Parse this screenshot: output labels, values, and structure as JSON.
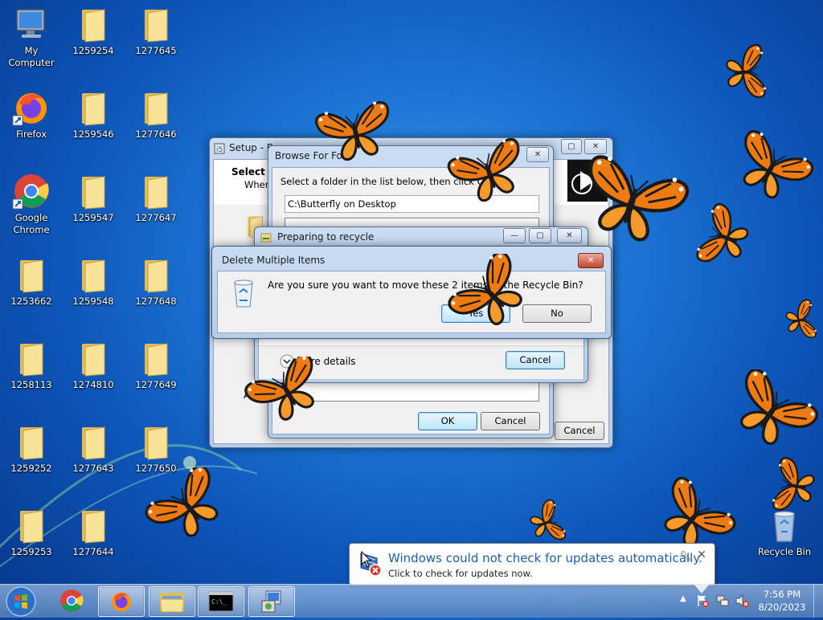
{
  "desktop": {
    "icons": [
      {
        "label": "My Computer",
        "icon": "computer-icon"
      },
      {
        "label": "1259254",
        "icon": "folder-icon"
      },
      {
        "label": "1277645",
        "icon": "folder-icon"
      },
      {
        "label": "Firefox",
        "icon": "firefox-icon"
      },
      {
        "label": "1259546",
        "icon": "folder-icon"
      },
      {
        "label": "1277646",
        "icon": "folder-icon"
      },
      {
        "label": "Google Chrome",
        "icon": "chrome-icon"
      },
      {
        "label": "1259547",
        "icon": "folder-icon"
      },
      {
        "label": "1277647",
        "icon": "folder-icon"
      },
      {
        "label": "1253662",
        "icon": "folder-icon"
      },
      {
        "label": "1259548",
        "icon": "folder-icon"
      },
      {
        "label": "1277648",
        "icon": "folder-icon"
      },
      {
        "label": "1258113",
        "icon": "folder-icon"
      },
      {
        "label": "1274810",
        "icon": "folder-icon"
      },
      {
        "label": "1277649",
        "icon": "folder-icon"
      },
      {
        "label": "1259252",
        "icon": "folder-icon"
      },
      {
        "label": "1277643",
        "icon": "folder-icon"
      },
      {
        "label": "1277650",
        "icon": "folder-icon"
      },
      {
        "label": "1259253",
        "icon": "folder-icon"
      },
      {
        "label": "1277644",
        "icon": "folder-icon"
      }
    ],
    "recycle_bin": {
      "label": "Recycle Bin"
    }
  },
  "setup_window": {
    "title": "Setup - Butterfly on Desktop",
    "title_visible": "Setup - B",
    "heading": "Select D",
    "subheading": "Where",
    "footer_text": "At l",
    "cancel_label": "Cancel"
  },
  "browse_dialog": {
    "title": "Browse For Fold",
    "instruction": "Select a folder in the list below, then click OK.",
    "path_value": "C:\\Butterfly on Desktop",
    "ok_label": "OK",
    "cancel_label": "Cancel"
  },
  "recycle_progress": {
    "title": "Preparing to recycle",
    "more_details_label": "More details",
    "cancel_label": "Cancel"
  },
  "delete_dialog": {
    "title": "Delete Multiple Items",
    "message": "Are you sure you want to move these 2 items to the Recycle Bin?",
    "yes_label": "Yes",
    "no_label": "No"
  },
  "notification": {
    "title": "Windows could not check for updates automatically.",
    "body": "Click to check for updates now."
  },
  "taskbar": {
    "items": [
      {
        "name": "chrome",
        "icon": "chrome-icon"
      },
      {
        "name": "firefox",
        "icon": "firefox-icon"
      },
      {
        "name": "explorer",
        "icon": "folder-icon"
      },
      {
        "name": "command-prompt",
        "icon": "cmd-icon"
      },
      {
        "name": "setup",
        "icon": "installer-icon"
      }
    ],
    "clock_time": "7:56 PM",
    "clock_date": "8/20/2023"
  },
  "colors": {
    "desktop_blue": "#1f78d8",
    "butterfly_orange": "#f07c10",
    "link_blue": "#1a5fb4"
  }
}
